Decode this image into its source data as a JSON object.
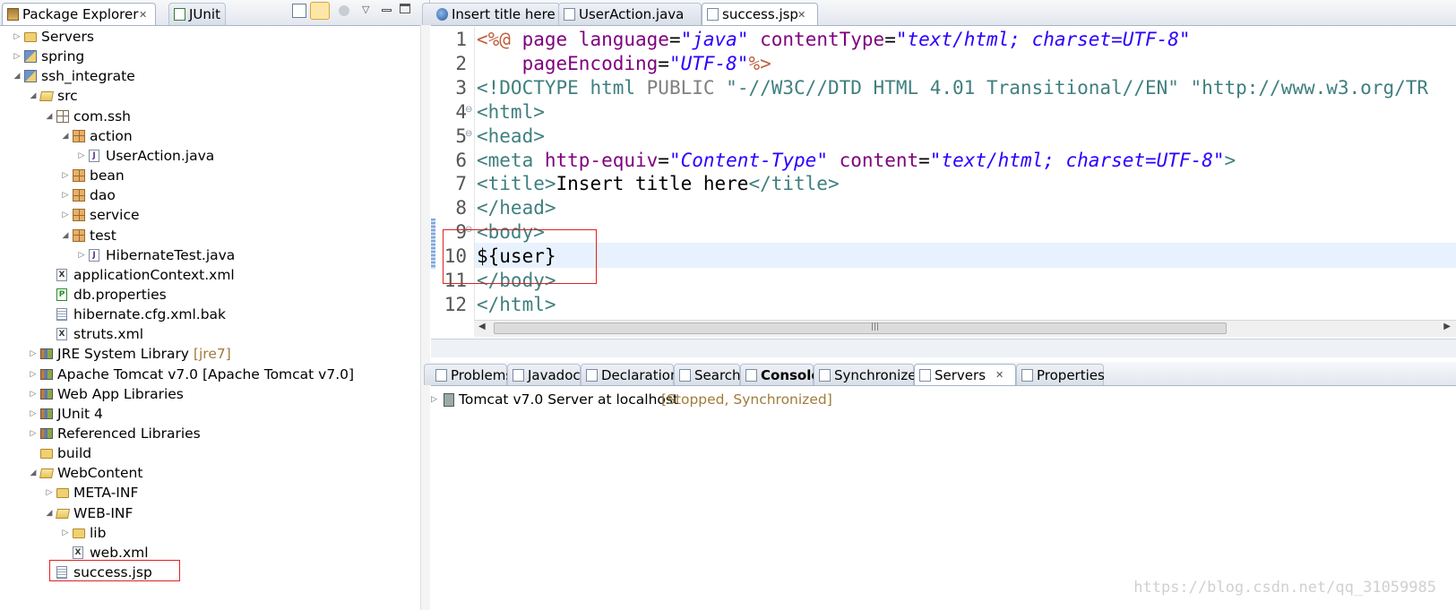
{
  "explorer": {
    "tabs": [
      {
        "label": "Package Explorer",
        "icon": "package-explorer-icon",
        "closable": true
      },
      {
        "label": "JUnit",
        "icon": "junit-icon"
      }
    ],
    "toolbar": {
      "collapse_all": "collapse-all-icon",
      "link_with_editor": "link-with-editor-icon",
      "view_menu": "view-menu-icon",
      "minimize": "minimize-icon",
      "maximize": "maximize-icon"
    },
    "tree": [
      {
        "label": "Servers",
        "icon": "folder-icon",
        "arrow": "collapsed"
      },
      {
        "label": "spring",
        "icon": "project-icon",
        "arrow": "collapsed"
      },
      {
        "label": "ssh_integrate",
        "icon": "project-icon",
        "arrow": "expanded"
      },
      {
        "label": "src",
        "icon": "source-folder-icon",
        "arrow": "expanded"
      },
      {
        "label": "com.ssh",
        "icon": "empty-package-icon",
        "arrow": "expanded"
      },
      {
        "label": "action",
        "icon": "package-icon",
        "arrow": "expanded"
      },
      {
        "label": "UserAction.java",
        "icon": "java-file-icon",
        "arrow": "collapsed"
      },
      {
        "label": "bean",
        "icon": "package-icon",
        "arrow": "collapsed"
      },
      {
        "label": "dao",
        "icon": "package-icon",
        "arrow": "collapsed"
      },
      {
        "label": "service",
        "icon": "package-icon",
        "arrow": "collapsed"
      },
      {
        "label": "test",
        "icon": "package-icon",
        "arrow": "expanded"
      },
      {
        "label": "HibernateTest.java",
        "icon": "java-file-icon",
        "arrow": "collapsed"
      },
      {
        "label": "applicationContext.xml",
        "icon": "xml-file-icon",
        "arrow": "none"
      },
      {
        "label": "db.properties",
        "icon": "properties-file-icon",
        "arrow": "none"
      },
      {
        "label": "hibernate.cfg.xml.bak",
        "icon": "text-file-icon",
        "arrow": "none"
      },
      {
        "label": "struts.xml",
        "icon": "xml-file-icon",
        "arrow": "none"
      },
      {
        "label": "JRE System Library",
        "decoration": "[jre7]",
        "icon": "library-icon",
        "arrow": "collapsed"
      },
      {
        "label": "Apache Tomcat v7.0 [Apache Tomcat v7.0]",
        "icon": "library-icon",
        "arrow": "collapsed"
      },
      {
        "label": "Web App Libraries",
        "icon": "library-icon",
        "arrow": "collapsed"
      },
      {
        "label": "JUnit 4",
        "icon": "library-icon",
        "arrow": "collapsed"
      },
      {
        "label": "Referenced Libraries",
        "icon": "library-icon",
        "arrow": "collapsed"
      },
      {
        "label": "build",
        "icon": "folder-icon",
        "arrow": "none"
      },
      {
        "label": "WebContent",
        "icon": "open-folder-icon",
        "arrow": "expanded"
      },
      {
        "label": "META-INF",
        "icon": "folder-icon",
        "arrow": "collapsed"
      },
      {
        "label": "WEB-INF",
        "icon": "open-folder-icon",
        "arrow": "expanded"
      },
      {
        "label": "lib",
        "icon": "folder-icon",
        "arrow": "collapsed"
      },
      {
        "label": "web.xml",
        "icon": "xml-file-icon",
        "arrow": "none"
      },
      {
        "label": "success.jsp",
        "icon": "jsp-file-icon",
        "arrow": "none"
      }
    ]
  },
  "editor": {
    "tabs": [
      {
        "label": "Insert title here",
        "icon": "browser-icon"
      },
      {
        "label": "UserAction.java",
        "icon": "java-file-icon"
      },
      {
        "label": "success.jsp",
        "icon": "jsp-file-icon",
        "active": true,
        "closable": true
      }
    ],
    "line_numbers": [
      "1",
      "2",
      "3",
      "4",
      "5",
      "6",
      "7",
      "8",
      "9",
      "10",
      "11",
      "12"
    ],
    "lines": [
      [
        [
          "jsp",
          "<%@ "
        ],
        [
          "attr",
          "page "
        ],
        [
          "attr",
          "language"
        ],
        [
          "text",
          "="
        ],
        [
          "val",
          "\"java\""
        ],
        [
          "text",
          " "
        ],
        [
          "attr",
          "contentType"
        ],
        [
          "text",
          "="
        ],
        [
          "val",
          "\"text/html; charset=UTF-8\""
        ]
      ],
      [
        [
          "text",
          "    "
        ],
        [
          "attr",
          "pageEncoding"
        ],
        [
          "text",
          "="
        ],
        [
          "val",
          "\"UTF-8\""
        ],
        [
          "jsp",
          "%>"
        ]
      ],
      [
        [
          "doc",
          "<!DOCTYPE "
        ],
        [
          "doc",
          "html "
        ],
        [
          "dockw",
          "PUBLIC "
        ],
        [
          "docstr",
          "\"-//W3C//DTD HTML 4.01 Transitional//EN\" \"http://www.w3.org/TR"
        ]
      ],
      [
        [
          "tag",
          "<html>"
        ]
      ],
      [
        [
          "tag",
          "<head>"
        ]
      ],
      [
        [
          "tag",
          "<meta "
        ],
        [
          "attr",
          "http-equiv"
        ],
        [
          "text",
          "="
        ],
        [
          "val",
          "\"Content-Type\""
        ],
        [
          "text",
          " "
        ],
        [
          "attr",
          "content"
        ],
        [
          "text",
          "="
        ],
        [
          "val",
          "\"text/html; charset=UTF-8\""
        ],
        [
          "tag",
          ">"
        ]
      ],
      [
        [
          "tag",
          "<title>"
        ],
        [
          "text",
          "Insert title here"
        ],
        [
          "tag",
          "</title>"
        ]
      ],
      [
        [
          "tag",
          "</head>"
        ]
      ],
      [
        [
          "tag",
          "<body>"
        ]
      ],
      [
        [
          "text",
          "${user}"
        ]
      ],
      [
        [
          "tag",
          "</body>"
        ]
      ],
      [
        [
          "tag",
          "</html>"
        ]
      ]
    ],
    "fold_markers": [
      "⊖",
      "⊖",
      "⊖"
    ],
    "scroll_grip": "|||"
  },
  "panel": {
    "tabs": [
      {
        "label": "Problems",
        "icon": "problems-icon"
      },
      {
        "label": "Javadoc",
        "icon": "javadoc-icon"
      },
      {
        "label": "Declaration",
        "icon": "declaration-icon"
      },
      {
        "label": "Search",
        "icon": "search-icon"
      },
      {
        "label": "Console",
        "icon": "console-icon",
        "bold": true
      },
      {
        "label": "Synchronize",
        "icon": "synchronize-icon"
      },
      {
        "label": "Servers",
        "icon": "servers-icon",
        "active": true,
        "closable": true
      },
      {
        "label": "Properties",
        "icon": "properties-icon"
      }
    ],
    "server_row": {
      "label": "Tomcat v7.0 Server at localhost",
      "status": "[Stopped, Synchronized]"
    }
  },
  "watermark": "https://blog.csdn.net/qq_31059985",
  "colors": {
    "highlight_box": "#e0201f",
    "current_line": "#e8f2fe",
    "decoration": "#a07c3a"
  }
}
